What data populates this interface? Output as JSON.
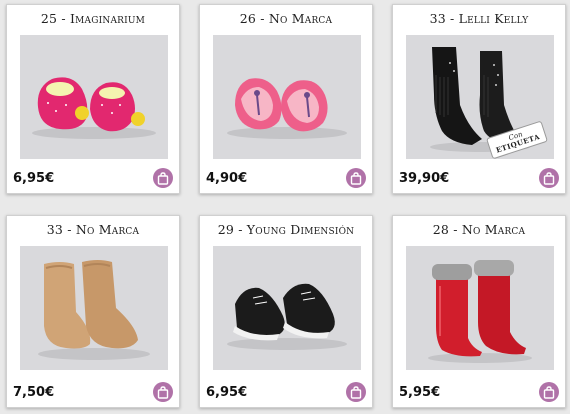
{
  "products": [
    {
      "title": "25 - Imaginarium",
      "price": "6,95€",
      "image": "pink-slippers-pompom"
    },
    {
      "title": "26 - No Marca",
      "price": "4,90€",
      "image": "pink-slippers-giraffe"
    },
    {
      "title": "33 - Lelli Kelly",
      "price": "39,90€",
      "image": "black-fringe-boots",
      "tag_line1": "Con",
      "tag_line2": "ETIQUETA"
    },
    {
      "title": "33 - No Marca",
      "price": "7,50€",
      "image": "tan-sheepskin-boots"
    },
    {
      "title": "29 - Young Dimensión",
      "price": "6,95€",
      "image": "black-sneakers"
    },
    {
      "title": "28 - No Marca",
      "price": "5,95€",
      "image": "red-rain-boots"
    }
  ],
  "colors": {
    "background": "#e9e9e9",
    "cart_button": "#b072a8",
    "image_bg": "#d9d9dc"
  },
  "icons": {
    "cart": "shopping-bag-icon"
  }
}
